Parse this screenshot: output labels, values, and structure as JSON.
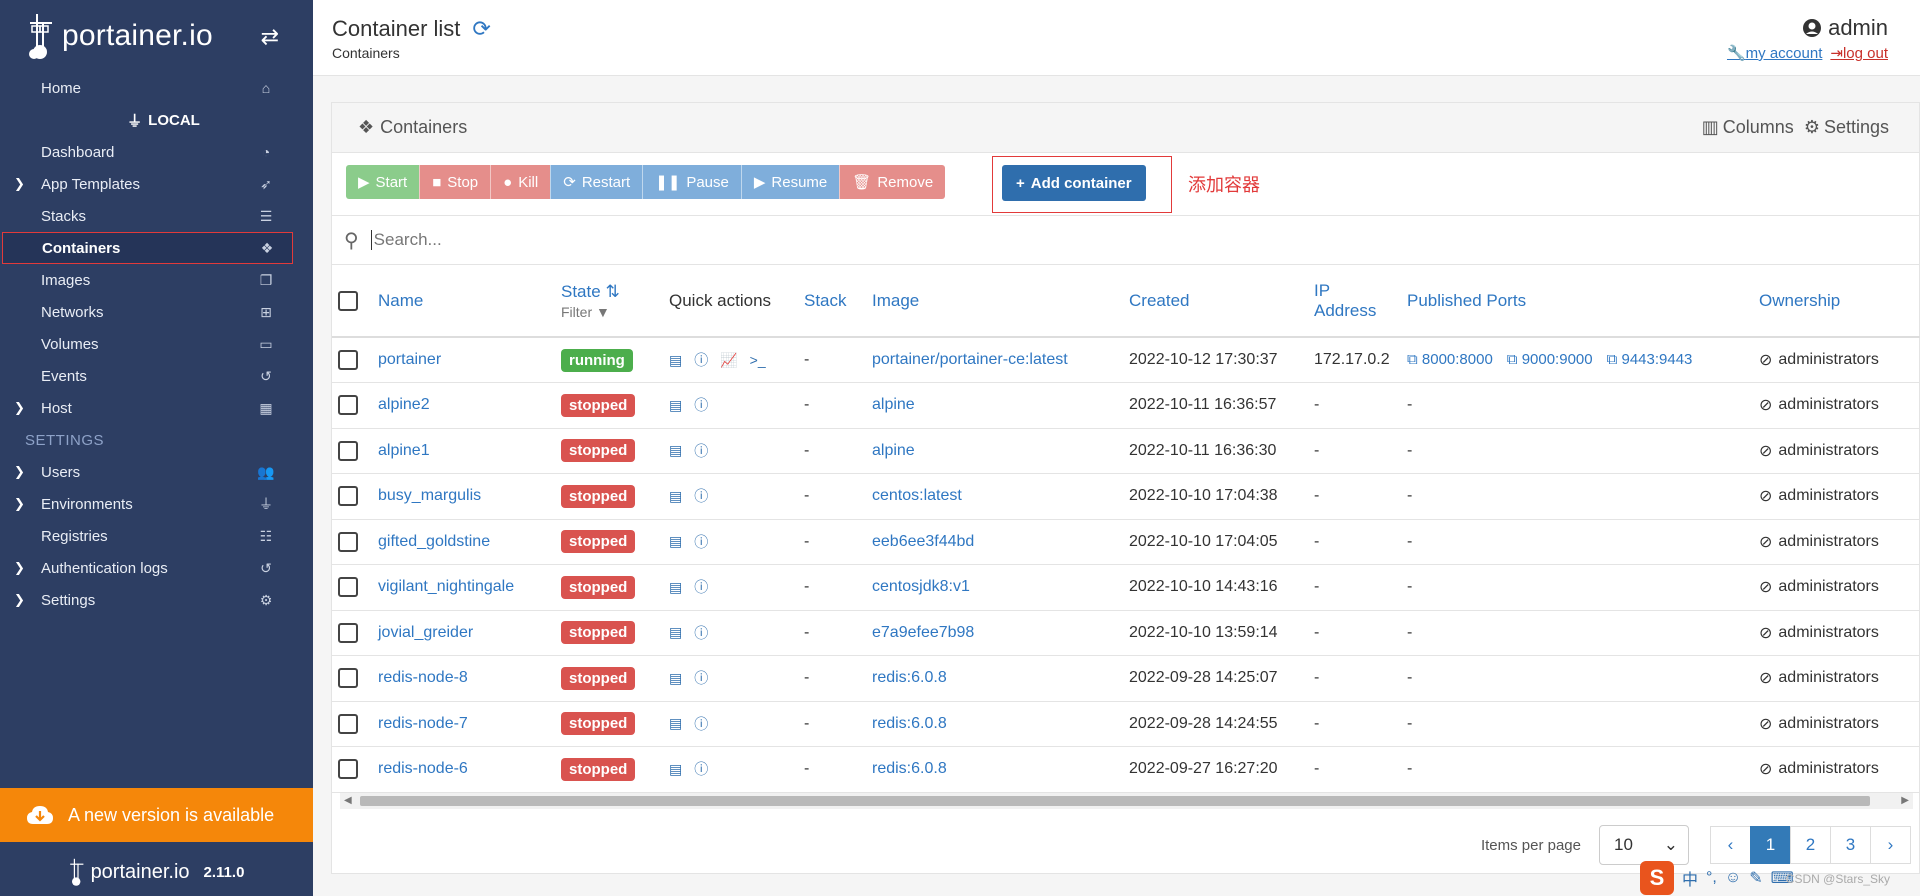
{
  "brand": {
    "name": "portainer.io"
  },
  "sidebar": {
    "items_top": [
      {
        "label": "Home",
        "icon": "home-icon",
        "glyph": "⌂",
        "caret": false
      }
    ],
    "environment": "LOCAL",
    "items_env": [
      {
        "label": "Dashboard",
        "icon": "dashboard-icon",
        "glyph": "◔",
        "caret": false
      },
      {
        "label": "App Templates",
        "icon": "rocket-icon",
        "glyph": "➶",
        "caret": true
      },
      {
        "label": "Stacks",
        "icon": "list-icon",
        "glyph": "☰",
        "caret": false
      },
      {
        "label": "Containers",
        "icon": "cubes-icon",
        "glyph": "❖",
        "caret": false,
        "active": true
      },
      {
        "label": "Images",
        "icon": "clone-icon",
        "glyph": "❐",
        "caret": false
      },
      {
        "label": "Networks",
        "icon": "sitemap-icon",
        "glyph": "⊞",
        "caret": false
      },
      {
        "label": "Volumes",
        "icon": "hdd-icon",
        "glyph": "▭",
        "caret": false
      },
      {
        "label": "Events",
        "icon": "history-icon",
        "glyph": "↺",
        "caret": false
      },
      {
        "label": "Host",
        "icon": "th-icon",
        "glyph": "▦",
        "caret": true
      }
    ],
    "settings_title": "SETTINGS",
    "items_settings": [
      {
        "label": "Users",
        "icon": "users-icon",
        "glyph": "👥",
        "caret": true
      },
      {
        "label": "Environments",
        "icon": "plug-icon",
        "glyph": "⏚",
        "caret": true
      },
      {
        "label": "Registries",
        "icon": "database-icon",
        "glyph": "☷",
        "caret": false
      },
      {
        "label": "Authentication logs",
        "icon": "history-icon",
        "glyph": "↺",
        "caret": true
      },
      {
        "label": "Settings",
        "icon": "cogs-icon",
        "glyph": "⚙",
        "caret": true
      }
    ],
    "update_banner": "A new version is available",
    "footer_logo": "portainer.io",
    "version": "2.11.0"
  },
  "header": {
    "title": "Container list",
    "breadcrumb": "Containers",
    "user": "admin",
    "my_account": "my account",
    "logout": "log out"
  },
  "panel": {
    "title": "Containers",
    "columns_label": "Columns",
    "settings_label": "Settings",
    "actions": {
      "start": "Start",
      "stop": "Stop",
      "kill": "Kill",
      "restart": "Restart",
      "pause": "Pause",
      "resume": "Resume",
      "remove": "Remove",
      "add": "Add container"
    },
    "annotation": "添加容器",
    "search_placeholder": "Search..."
  },
  "table": {
    "headers": {
      "name": "Name",
      "state": "State",
      "filter": "Filter",
      "quick_actions": "Quick actions",
      "stack": "Stack",
      "image": "Image",
      "created": "Created",
      "ip": "IP Address",
      "ports": "Published Ports",
      "ownership": "Ownership"
    },
    "rows": [
      {
        "name": "portainer",
        "state": "running",
        "stack": "-",
        "image": "portainer/portainer-ce:latest",
        "created": "2022-10-12 17:30:37",
        "ip": "172.17.0.2",
        "ports": [
          "8000:8000",
          "9000:9000",
          "9443:9443"
        ],
        "ownership": "administrators",
        "full_actions": true
      },
      {
        "name": "alpine2",
        "state": "stopped",
        "stack": "-",
        "image": "alpine",
        "created": "2022-10-11 16:36:57",
        "ip": "-",
        "ports": [],
        "ownership": "administrators"
      },
      {
        "name": "alpine1",
        "state": "stopped",
        "stack": "-",
        "image": "alpine",
        "created": "2022-10-11 16:36:30",
        "ip": "-",
        "ports": [],
        "ownership": "administrators"
      },
      {
        "name": "busy_margulis",
        "state": "stopped",
        "stack": "-",
        "image": "centos:latest",
        "created": "2022-10-10 17:04:38",
        "ip": "-",
        "ports": [],
        "ownership": "administrators"
      },
      {
        "name": "gifted_goldstine",
        "state": "stopped",
        "stack": "-",
        "image": "eeb6ee3f44bd",
        "created": "2022-10-10 17:04:05",
        "ip": "-",
        "ports": [],
        "ownership": "administrators"
      },
      {
        "name": "vigilant_nightingale",
        "state": "stopped",
        "stack": "-",
        "image": "centosjdk8:v1",
        "created": "2022-10-10 14:43:16",
        "ip": "-",
        "ports": [],
        "ownership": "administrators"
      },
      {
        "name": "jovial_greider",
        "state": "stopped",
        "stack": "-",
        "image": "e7a9efee7b98",
        "created": "2022-10-10 13:59:14",
        "ip": "-",
        "ports": [],
        "ownership": "administrators"
      },
      {
        "name": "redis-node-8",
        "state": "stopped",
        "stack": "-",
        "image": "redis:6.0.8",
        "created": "2022-09-28 14:25:07",
        "ip": "-",
        "ports": [],
        "ownership": "administrators"
      },
      {
        "name": "redis-node-7",
        "state": "stopped",
        "stack": "-",
        "image": "redis:6.0.8",
        "created": "2022-09-28 14:24:55",
        "ip": "-",
        "ports": [],
        "ownership": "administrators"
      },
      {
        "name": "redis-node-6",
        "state": "stopped",
        "stack": "-",
        "image": "redis:6.0.8",
        "created": "2022-09-27 16:27:20",
        "ip": "-",
        "ports": [],
        "ownership": "administrators"
      }
    ]
  },
  "pagination": {
    "items_per_page_label": "Items per page",
    "items_per_page": "10",
    "prev": "‹",
    "pages": [
      "1",
      "2",
      "3"
    ],
    "next": "›",
    "current": "1"
  },
  "ime": {
    "logo": "S",
    "lang": "中",
    "watermark": "CSDN @Stars_Sky"
  }
}
